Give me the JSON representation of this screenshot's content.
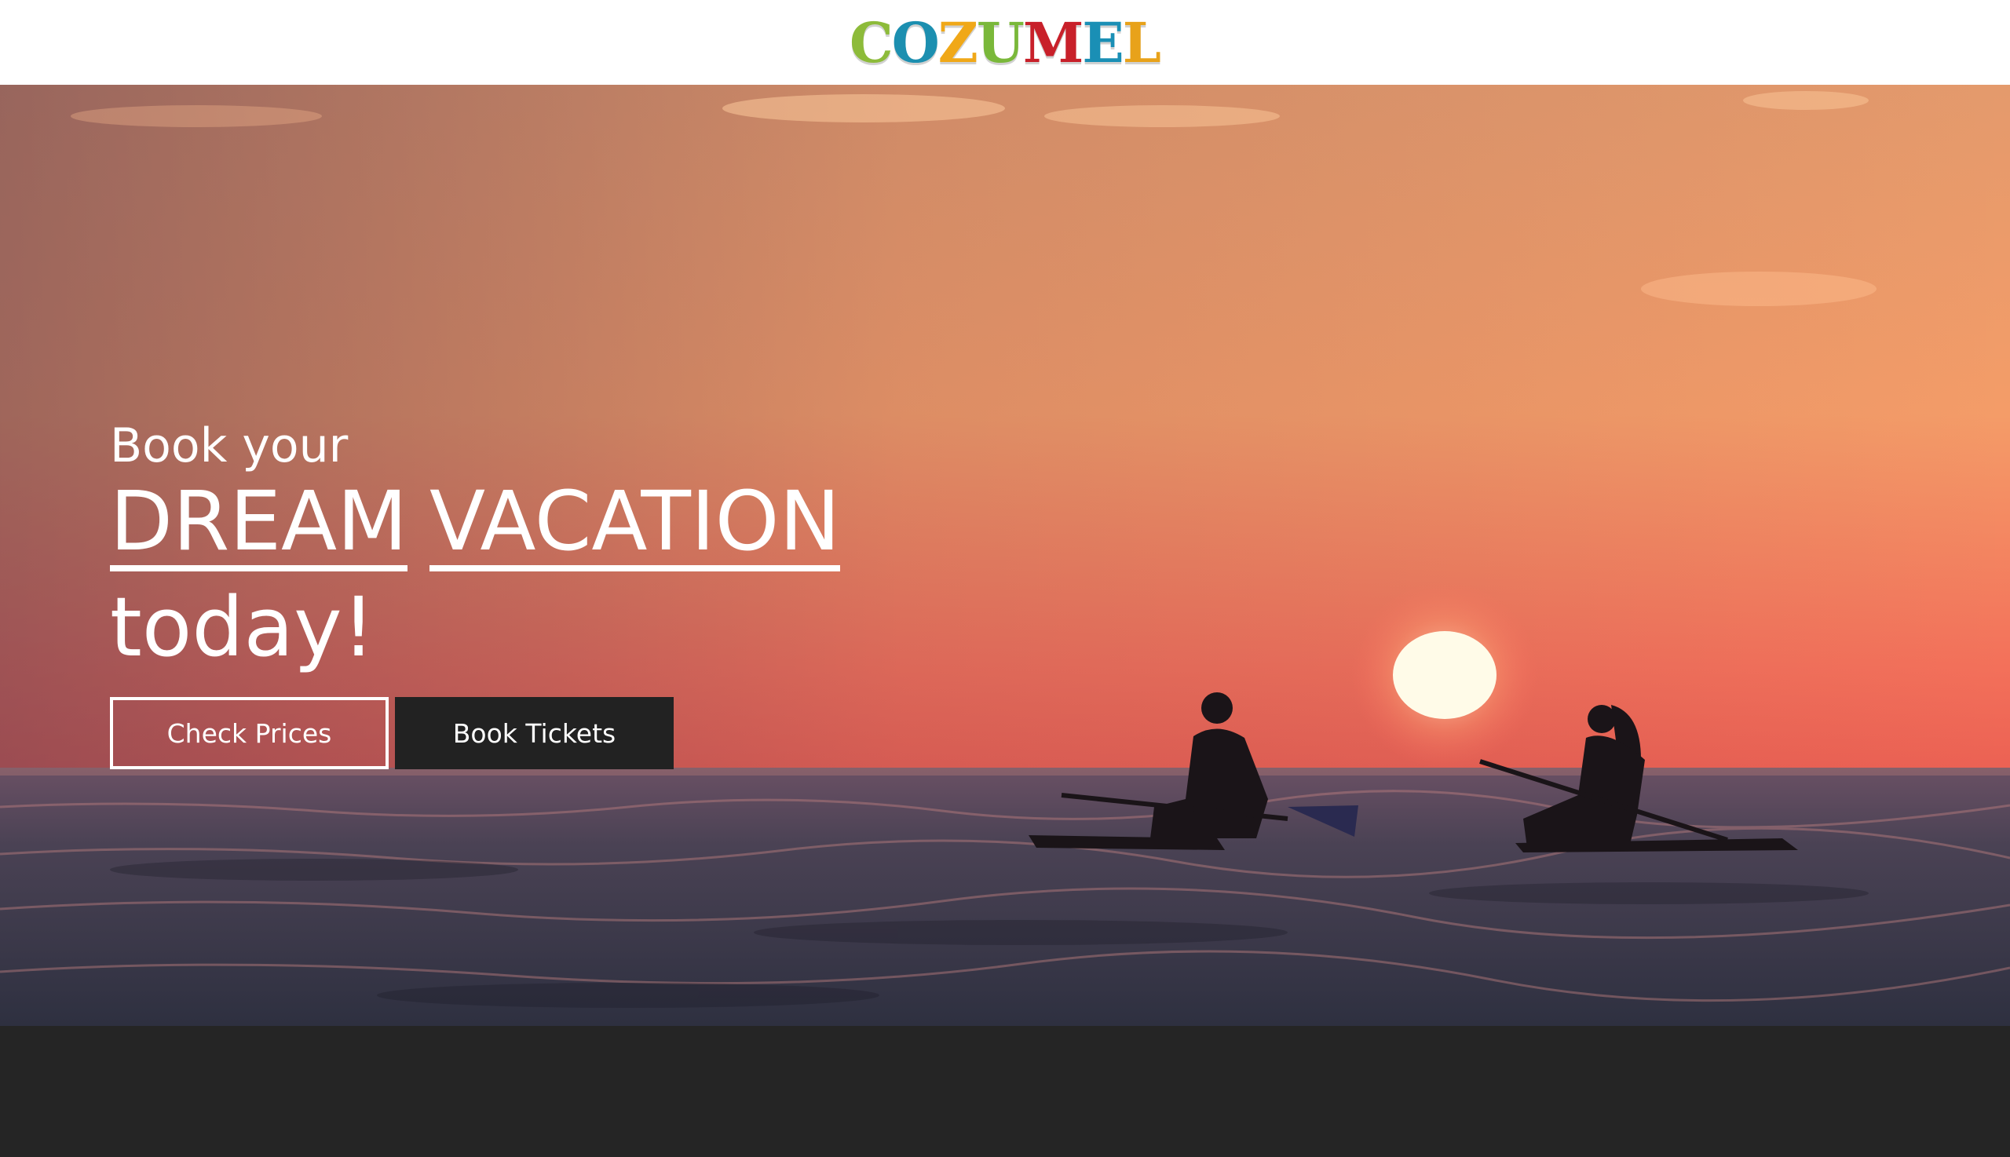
{
  "header": {
    "logo_letters": [
      {
        "char": "C",
        "color": "#8dbb3a"
      },
      {
        "char": "O",
        "color": "#1c8fb0"
      },
      {
        "char": "Z",
        "color": "#f0a818"
      },
      {
        "char": "U",
        "color": "#7ab83a"
      },
      {
        "char": "M",
        "color": "#c8202a"
      },
      {
        "char": "E",
        "color": "#1a8fb5"
      },
      {
        "char": "L",
        "color": "#e8a21a"
      }
    ]
  },
  "hero": {
    "intro": "Book your",
    "highlight_word_1": "DREAM",
    "highlight_word_2": "VACATION",
    "outro": "today!",
    "check_prices_label": "Check Prices",
    "book_tickets_label": "Book Tickets"
  },
  "colors": {
    "sky_top": "#e8a070",
    "sky_mid": "#f39a6a",
    "sky_horizon": "#f05a4a",
    "sea": "#3b3a4a",
    "footer": "#252525",
    "button_dark": "#222222"
  }
}
